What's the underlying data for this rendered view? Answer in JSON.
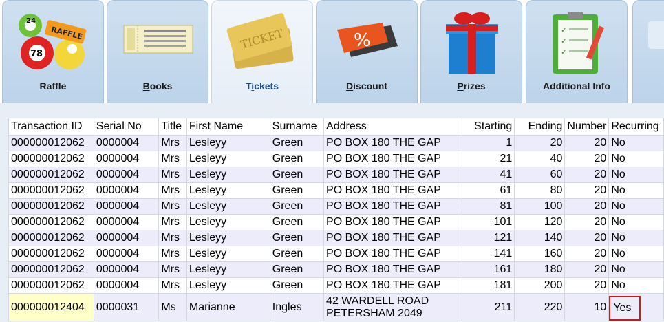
{
  "tabs": [
    {
      "label": "Raffle",
      "icon": "raffle-balls-icon",
      "underline": "",
      "rest": "Raffle"
    },
    {
      "label": "Books",
      "icon": "ticket-book-icon",
      "underline": "B",
      "rest": "ooks"
    },
    {
      "label": "Tickets",
      "icon": "gold-tickets-icon",
      "underline": "i",
      "pre": "T",
      "rest": "ckets",
      "active": true
    },
    {
      "label": "Discount",
      "icon": "discount-tag-icon",
      "underline": "D",
      "rest": "iscount"
    },
    {
      "label": "Prizes",
      "icon": "gift-box-icon",
      "underline": "P",
      "rest": "rizes"
    },
    {
      "label": "Additional Info",
      "icon": "clipboard-checklist-icon",
      "underline": "",
      "rest": "Additional Info"
    }
  ],
  "table": {
    "columns": [
      "Transaction ID",
      "Serial No",
      "Title",
      "First Name",
      "Surname",
      "Address",
      "Starting",
      "Ending",
      "Number",
      "Recurring"
    ],
    "rows": [
      [
        "000000012062",
        "0000004",
        "Mrs",
        "Lesleyy",
        "Green",
        "PO BOX 180 THE GAP",
        "1",
        "20",
        "20",
        "No"
      ],
      [
        "000000012062",
        "0000004",
        "Mrs",
        "Lesleyy",
        "Green",
        "PO BOX 180 THE GAP",
        "21",
        "40",
        "20",
        "No"
      ],
      [
        "000000012062",
        "0000004",
        "Mrs",
        "Lesleyy",
        "Green",
        "PO BOX 180 THE GAP",
        "41",
        "60",
        "20",
        "No"
      ],
      [
        "000000012062",
        "0000004",
        "Mrs",
        "Lesleyy",
        "Green",
        "PO BOX 180 THE GAP",
        "61",
        "80",
        "20",
        "No"
      ],
      [
        "000000012062",
        "0000004",
        "Mrs",
        "Lesleyy",
        "Green",
        "PO BOX 180 THE GAP",
        "81",
        "100",
        "20",
        "No"
      ],
      [
        "000000012062",
        "0000004",
        "Mrs",
        "Lesleyy",
        "Green",
        "PO BOX 180 THE GAP",
        "101",
        "120",
        "20",
        "No"
      ],
      [
        "000000012062",
        "0000004",
        "Mrs",
        "Lesleyy",
        "Green",
        "PO BOX 180 THE GAP",
        "121",
        "140",
        "20",
        "No"
      ],
      [
        "000000012062",
        "0000004",
        "Mrs",
        "Lesleyy",
        "Green",
        "PO BOX 180 THE GAP",
        "141",
        "160",
        "20",
        "No"
      ],
      [
        "000000012062",
        "0000004",
        "Mrs",
        "Lesleyy",
        "Green",
        "PO BOX 180 THE GAP",
        "161",
        "180",
        "20",
        "No"
      ],
      [
        "000000012062",
        "0000004",
        "Mrs",
        "Lesleyy",
        "Green",
        "PO BOX 180 THE GAP",
        "181",
        "200",
        "20",
        "No"
      ]
    ],
    "last_row": {
      "transaction_id": "000000012404",
      "serial_no": "0000031",
      "title": "Ms",
      "first_name": "Marianne",
      "surname": "Ingles",
      "address_line1": "42 WARDELL ROAD",
      "address_line2": "PETERSHAM 2049",
      "starting": "211",
      "ending": "220",
      "number": "10",
      "recurring": "Yes"
    }
  },
  "colors": {
    "selected_cell": "#ffffc8",
    "highlight_border": "#d01818",
    "alt_row": "#ececfb",
    "active_tab_text": "#1a4c8c"
  }
}
